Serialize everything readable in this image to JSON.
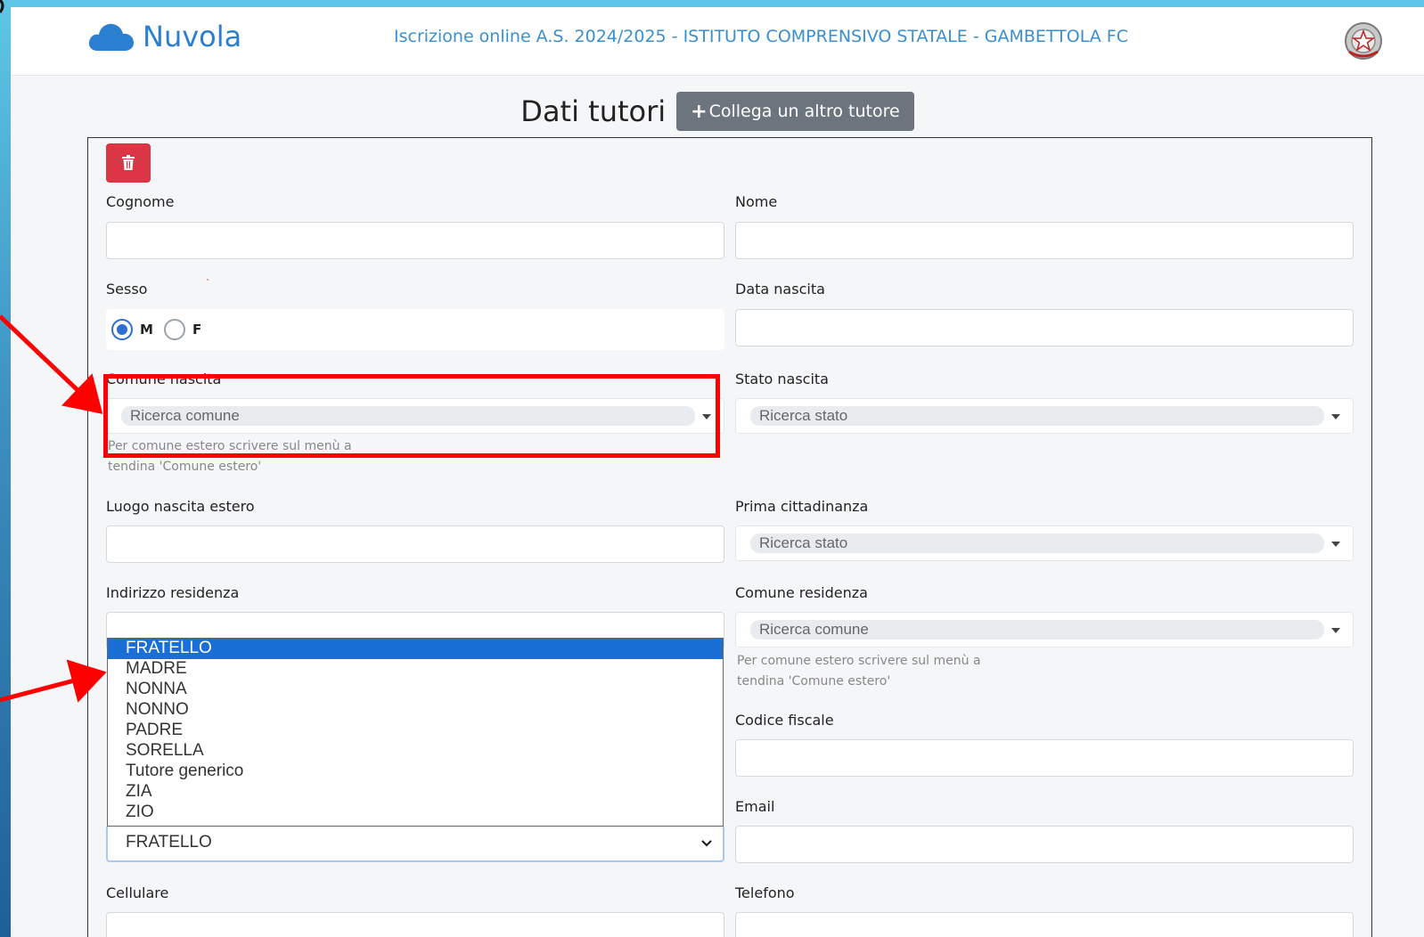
{
  "header": {
    "app_name": "Nuvola",
    "title": "Iscrizione online A.S. 2024/2025 - ISTITUTO COMPRENSIVO STATALE - GAMBETTOLA FC"
  },
  "page": {
    "title": "Dati tutori",
    "add_tutor_label": "Collega un altro tutore"
  },
  "form": {
    "cognome_label": "Cognome",
    "nome_label": "Nome",
    "sesso_label": "Sesso",
    "sesso_options": [
      "M",
      "F"
    ],
    "sesso_selected": "M",
    "data_nascita_label": "Data nascita",
    "comune_nascita_label": "Comune nascita",
    "comune_nascita_placeholder": "Ricerca comune",
    "comune_nascita_help_1": "Per comune estero scrivere sul menù a",
    "comune_nascita_help_2": "tendina 'Comune estero'",
    "stato_nascita_label": "Stato nascita",
    "stato_nascita_placeholder": "Ricerca stato",
    "luogo_nascita_estero_label": "Luogo nascita estero",
    "prima_cittadinanza_label": "Prima cittadinanza",
    "prima_cittadinanza_placeholder": "Ricerca stato",
    "indirizzo_residenza_label": "Indirizzo residenza",
    "comune_residenza_label": "Comune residenza",
    "comune_residenza_placeholder": "Ricerca comune",
    "comune_residenza_help_1": "Per comune estero scrivere sul menù a",
    "comune_residenza_help_2": "tendina 'Comune estero'",
    "codice_fiscale_label": "Codice fiscale",
    "email_label": "Email",
    "cellulare_label": "Cellulare",
    "telefono_label": "Telefono",
    "grado_parentela_value": "FRATELLO",
    "grado_parentela_options": [
      "FRATELLO",
      "MADRE",
      "NONNA",
      "NONNO",
      "PADRE",
      "SORELLA",
      "Tutore generico",
      "ZIA",
      "ZIO"
    ]
  },
  "colors": {
    "accent": "#2b7fd0",
    "delete": "#dc3545",
    "annotation": "#ff0000",
    "selected_option": "#1a6fd6"
  }
}
